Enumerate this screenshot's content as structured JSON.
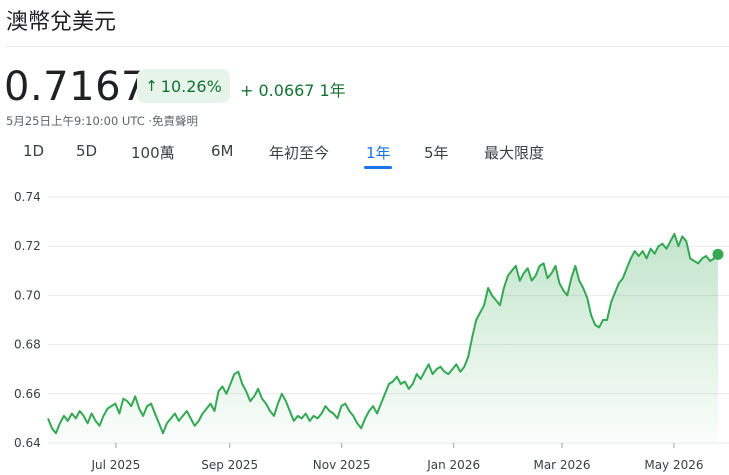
{
  "header": {
    "title": "澳幣兌美元"
  },
  "quote": {
    "price": "0.7167",
    "change_percent": "10.26%",
    "change_arrow": "↑",
    "change_abs": "+ 0.0667",
    "change_period": "1年",
    "timestamp": "5月25日上午9:10:00 UTC ·免責聲明"
  },
  "tabs": [
    {
      "label": "1D"
    },
    {
      "label": "5D"
    },
    {
      "label": "100萬"
    },
    {
      "label": "6M"
    },
    {
      "label": "年初至今"
    },
    {
      "label": "1年"
    },
    {
      "label": "5年"
    },
    {
      "label": "最大限度"
    }
  ],
  "active_tab": "1年",
  "colors": {
    "line": "#34a853",
    "fill_top": "#34a853",
    "positive_text": "#137333",
    "active_tab": "#1a73e8"
  },
  "chart_data": {
    "type": "area",
    "ylim": [
      0.64,
      0.74
    ],
    "yticks": [
      "0.74",
      "0.72",
      "0.70",
      "0.68",
      "0.66",
      "0.64"
    ],
    "ytick_values": [
      0.74,
      0.72,
      0.7,
      0.68,
      0.66,
      0.64
    ],
    "xticks": [
      "Jul 2025",
      "Sep 2025",
      "Nov 2025",
      "Jan 2026",
      "Mar 2026",
      "May 2026"
    ],
    "x_start": "2025-05-25",
    "x_end": "2026-05-25",
    "xtick_dates": [
      "2025-07-01",
      "2025-09-01",
      "2025-11-01",
      "2026-01-01",
      "2026-03-01",
      "2026-05-01"
    ],
    "series": [
      {
        "values": [
          0.65,
          0.646,
          0.644,
          0.648,
          0.651,
          0.649,
          0.652,
          0.65,
          0.653,
          0.651,
          0.648,
          0.652,
          0.649,
          0.647,
          0.651,
          0.654,
          0.655,
          0.656,
          0.652,
          0.658,
          0.657,
          0.655,
          0.659,
          0.654,
          0.651,
          0.655,
          0.656,
          0.652,
          0.648,
          0.644,
          0.648,
          0.65,
          0.652,
          0.649,
          0.651,
          0.653,
          0.65,
          0.647,
          0.649,
          0.652,
          0.654,
          0.656,
          0.653,
          0.661,
          0.663,
          0.66,
          0.664,
          0.668,
          0.669,
          0.664,
          0.661,
          0.657,
          0.659,
          0.662,
          0.658,
          0.656,
          0.653,
          0.651,
          0.656,
          0.66,
          0.657,
          0.653,
          0.649,
          0.651,
          0.65,
          0.652,
          0.649,
          0.651,
          0.65,
          0.652,
          0.655,
          0.653,
          0.652,
          0.65,
          0.655,
          0.656,
          0.653,
          0.651,
          0.648,
          0.646,
          0.65,
          0.653,
          0.655,
          0.652,
          0.656,
          0.66,
          0.664,
          0.665,
          0.667,
          0.664,
          0.665,
          0.662,
          0.664,
          0.668,
          0.666,
          0.669,
          0.672,
          0.668,
          0.67,
          0.671,
          0.669,
          0.668,
          0.67,
          0.672,
          0.669,
          0.671,
          0.675,
          0.683,
          0.69,
          0.693,
          0.696,
          0.703,
          0.7,
          0.698,
          0.696,
          0.703,
          0.708,
          0.71,
          0.712,
          0.706,
          0.709,
          0.711,
          0.706,
          0.708,
          0.712,
          0.713,
          0.707,
          0.709,
          0.712,
          0.705,
          0.702,
          0.7,
          0.707,
          0.712,
          0.706,
          0.703,
          0.699,
          0.692,
          0.688,
          0.687,
          0.69,
          0.69,
          0.697,
          0.701,
          0.705,
          0.707,
          0.711,
          0.715,
          0.718,
          0.716,
          0.718,
          0.715,
          0.719,
          0.717,
          0.72,
          0.721,
          0.719,
          0.722,
          0.725,
          0.72,
          0.724,
          0.722,
          0.715,
          0.714,
          0.713,
          0.715,
          0.716,
          0.714,
          0.715,
          0.7167
        ]
      }
    ]
  }
}
